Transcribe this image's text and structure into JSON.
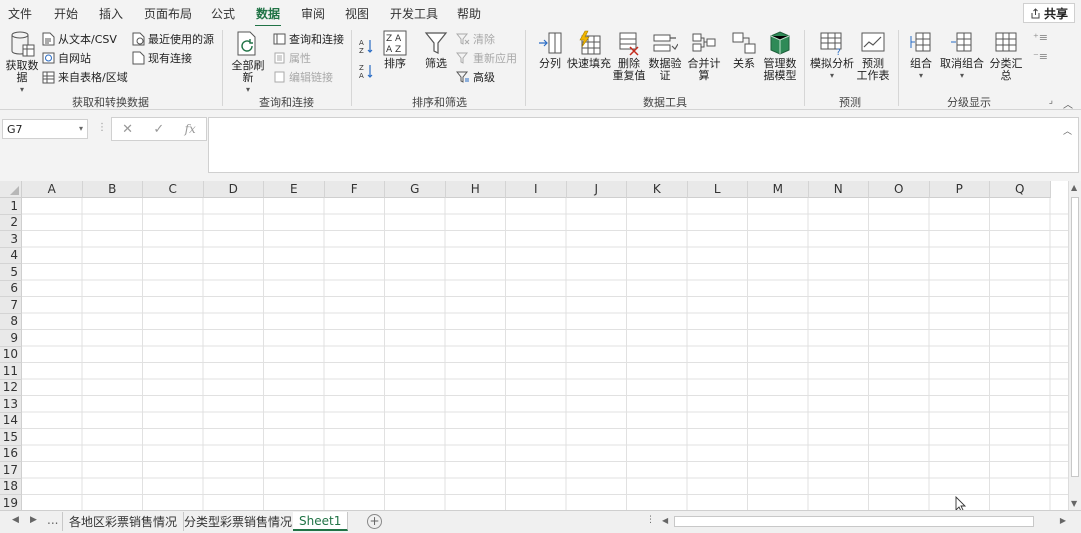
{
  "menu": {
    "tabs": [
      "文件",
      "开始",
      "插入",
      "页面布局",
      "公式",
      "数据",
      "审阅",
      "视图",
      "开发工具",
      "帮助"
    ],
    "active": "数据",
    "share_label": "共享"
  },
  "ribbon": {
    "get_transform": {
      "label": "获取和转换数据",
      "get_data": "获取数\n据",
      "from_text_csv": "从文本/CSV",
      "from_web": "自网站",
      "from_table": "来自表格/区域",
      "recent_sources": "最近使用的源",
      "existing_connections": "现有连接"
    },
    "queries": {
      "label": "查询和连接",
      "refresh_all": "全部刷新",
      "queries_connections": "查询和连接",
      "properties": "属性",
      "edit_links": "编辑链接"
    },
    "sort_filter": {
      "label": "排序和筛选",
      "sort": "排序",
      "filter": "筛选",
      "clear": "清除",
      "reapply": "重新应用",
      "advanced": "高级"
    },
    "data_tools": {
      "label": "数据工具",
      "text_to_columns": "分列",
      "flash_fill": "快速填充",
      "remove_duplicates": "删除\n重复值",
      "data_validation": "数据验\n证",
      "consolidate": "合并计算",
      "relationships": "关系",
      "manage_model": "管理数\n据模型"
    },
    "forecast": {
      "label": "预测",
      "what_if": "模拟分析",
      "forecast_sheet": "预测\n工作表"
    },
    "outline": {
      "label": "分级显示",
      "group": "组合",
      "ungroup": "取消组合",
      "subtotal": "分类汇总"
    }
  },
  "formula_bar": {
    "name_box": "G7",
    "formula": "",
    "fx": "fx"
  },
  "grid": {
    "columns": [
      "A",
      "B",
      "C",
      "D",
      "E",
      "F",
      "G",
      "H",
      "I",
      "J",
      "K",
      "L",
      "M",
      "N",
      "O",
      "P",
      "Q"
    ],
    "rows": [
      "1",
      "2",
      "3",
      "4",
      "5",
      "6",
      "7",
      "8",
      "9",
      "10",
      "11",
      "12",
      "13",
      "14",
      "15",
      "16",
      "17",
      "18",
      "19"
    ]
  },
  "sheets": {
    "ellipsis": "...",
    "tabs": [
      "各地区彩票销售情况",
      "分类型彩票销售情况",
      "Sheet1"
    ],
    "active": "Sheet1",
    "add_label": "+"
  },
  "colors": {
    "accent": "#217346",
    "ribbon_bg": "#f3f3f3",
    "gridline": "#e1e1e1"
  }
}
